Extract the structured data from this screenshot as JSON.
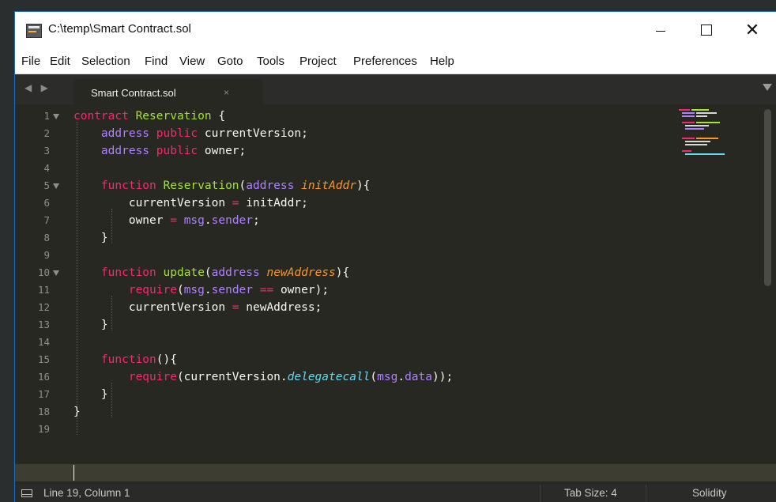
{
  "window": {
    "title": "C:\\temp\\Smart Contract.sol",
    "controls": {
      "minimize": "—",
      "maximize": "☐",
      "close": "✕"
    }
  },
  "menu": [
    "File",
    "Edit",
    "Selection",
    "Find",
    "View",
    "Goto",
    "Tools",
    "Project",
    "Preferences",
    "Help"
  ],
  "tabs": [
    {
      "label": "Smart Contract.sol",
      "close": "×"
    }
  ],
  "editor": {
    "line_numbers": [
      "1",
      "2",
      "3",
      "4",
      "5",
      "6",
      "7",
      "8",
      "9",
      "10",
      "11",
      "12",
      "13",
      "14",
      "15",
      "16",
      "17",
      "18",
      "19"
    ],
    "fold_markers_on_lines": [
      1,
      5,
      10
    ],
    "lines": [
      [
        {
          "t": "contract",
          "k": "kw"
        },
        {
          "t": " "
        },
        {
          "t": "Reservation",
          "k": "nm"
        },
        {
          "t": " {"
        }
      ],
      [
        {
          "t": "    "
        },
        {
          "t": "address",
          "k": "ty"
        },
        {
          "t": " "
        },
        {
          "t": "public",
          "k": "kw"
        },
        {
          "t": " currentVersion;"
        }
      ],
      [
        {
          "t": "    "
        },
        {
          "t": "address",
          "k": "ty"
        },
        {
          "t": " "
        },
        {
          "t": "public",
          "k": "kw"
        },
        {
          "t": " owner;"
        }
      ],
      [],
      [
        {
          "t": "    "
        },
        {
          "t": "function",
          "k": "kw"
        },
        {
          "t": " "
        },
        {
          "t": "Reservation",
          "k": "nm"
        },
        {
          "t": "("
        },
        {
          "t": "address",
          "k": "ty"
        },
        {
          "t": " "
        },
        {
          "t": "initAddr",
          "k": "pa"
        },
        {
          "t": "){"
        }
      ],
      [
        {
          "t": "        currentVersion "
        },
        {
          "t": "=",
          "k": "kw"
        },
        {
          "t": " initAddr;"
        }
      ],
      [
        {
          "t": "        owner "
        },
        {
          "t": "=",
          "k": "kw"
        },
        {
          "t": " "
        },
        {
          "t": "msg",
          "k": "ty"
        },
        {
          "t": "."
        },
        {
          "t": "sender",
          "k": "ty"
        },
        {
          "t": ";"
        }
      ],
      [
        {
          "t": "    }"
        }
      ],
      [],
      [
        {
          "t": "    "
        },
        {
          "t": "function",
          "k": "kw"
        },
        {
          "t": " "
        },
        {
          "t": "update",
          "k": "nm"
        },
        {
          "t": "("
        },
        {
          "t": "address",
          "k": "ty"
        },
        {
          "t": " "
        },
        {
          "t": "newAddress",
          "k": "pa"
        },
        {
          "t": "){"
        }
      ],
      [
        {
          "t": "        "
        },
        {
          "t": "require",
          "k": "kw"
        },
        {
          "t": "("
        },
        {
          "t": "msg",
          "k": "ty"
        },
        {
          "t": "."
        },
        {
          "t": "sender",
          "k": "ty"
        },
        {
          "t": " "
        },
        {
          "t": "==",
          "k": "kw"
        },
        {
          "t": " owner);"
        }
      ],
      [
        {
          "t": "        currentVersion "
        },
        {
          "t": "=",
          "k": "kw"
        },
        {
          "t": " newAddress;"
        }
      ],
      [
        {
          "t": "    }"
        }
      ],
      [],
      [
        {
          "t": "    "
        },
        {
          "t": "function",
          "k": "kw"
        },
        {
          "t": "(){"
        }
      ],
      [
        {
          "t": "        "
        },
        {
          "t": "require",
          "k": "kw"
        },
        {
          "t": "(currentVersion."
        },
        {
          "t": "delegatecall",
          "k": "cl"
        },
        {
          "t": "("
        },
        {
          "t": "msg",
          "k": "ty"
        },
        {
          "t": "."
        },
        {
          "t": "data",
          "k": "ty"
        },
        {
          "t": "));"
        }
      ],
      [
        {
          "t": "    }"
        }
      ],
      [
        {
          "t": "}"
        }
      ],
      []
    ],
    "current_line": 19
  },
  "colors": {
    "keyword": "#f92672",
    "type": "#ae81ff",
    "name": "#a6e22e",
    "param": "#fd971f",
    "call": "#66d9ef",
    "text": "#f8f8f2",
    "background": "#272822",
    "line_number": "#8f908a"
  },
  "status": {
    "position": "Line 19, Column 1",
    "tab_size": "Tab Size: 4",
    "syntax": "Solidity"
  }
}
